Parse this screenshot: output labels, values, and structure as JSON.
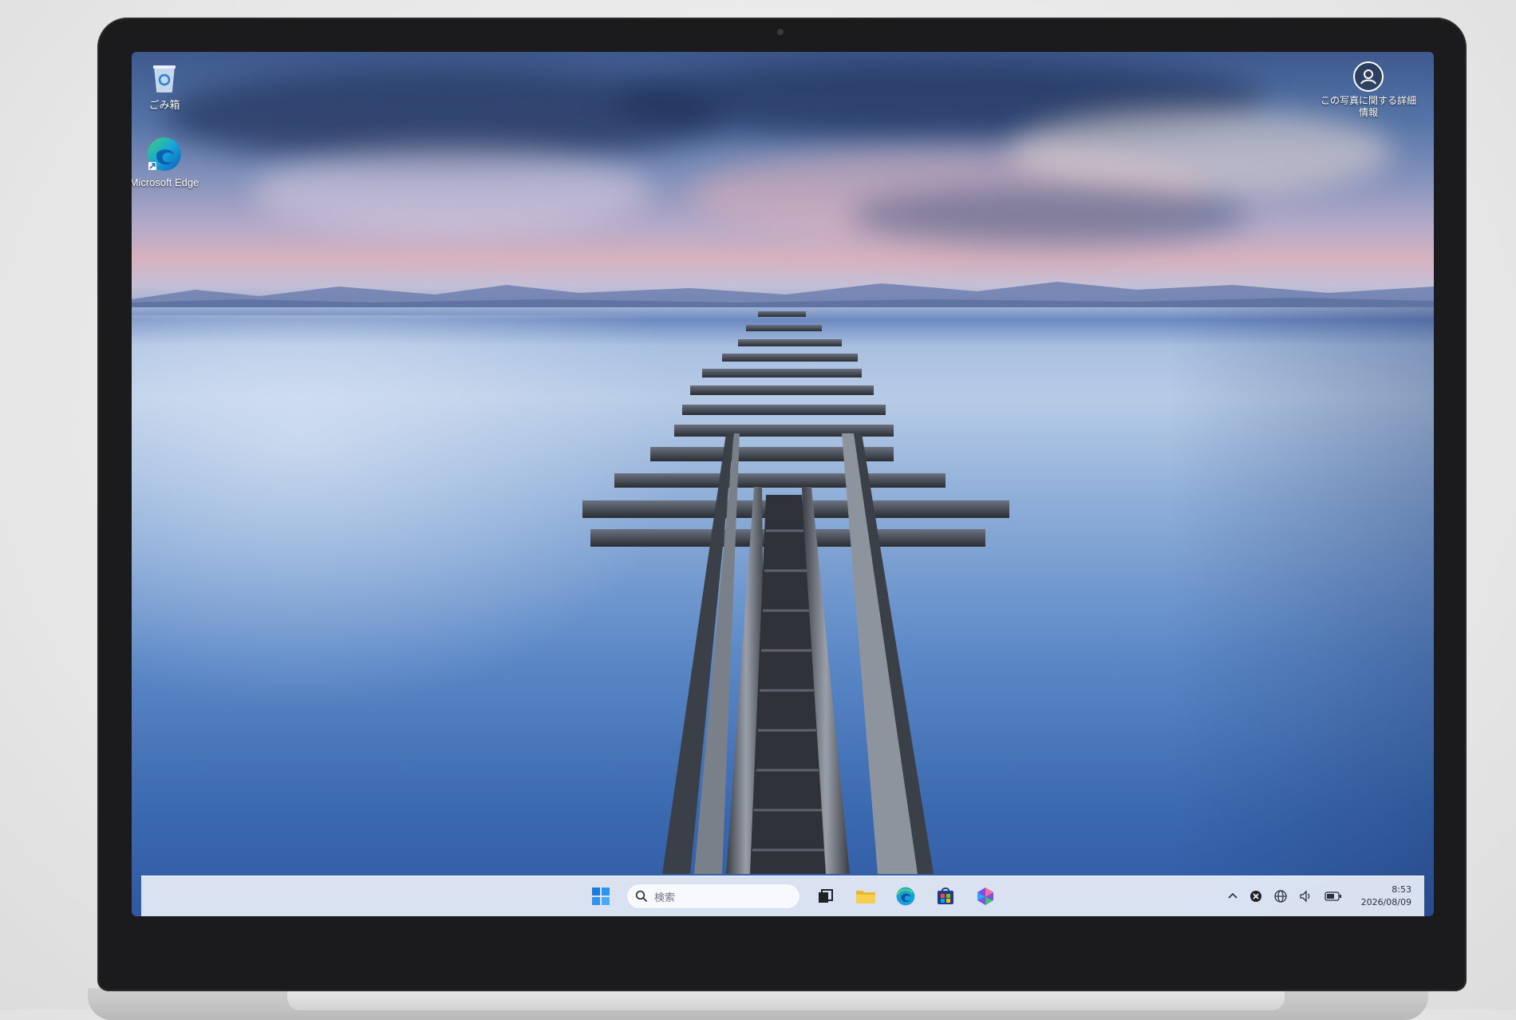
{
  "desktop": {
    "icons": [
      {
        "label": "ごみ箱",
        "icon": "recycle-bin-icon"
      },
      {
        "label": "Microsoft Edge",
        "icon": "edge-icon"
      }
    ],
    "about_photo": {
      "label": "この写真に関する詳細情報",
      "icon": "camera-info-icon"
    }
  },
  "taskbar": {
    "search_placeholder": "検索",
    "apps": [
      "start-icon",
      "task-view-icon",
      "file-explorer-icon",
      "edge-icon",
      "store-icon",
      "m365-icon"
    ],
    "tray_icons": [
      "chevron-up-icon",
      "close-circle-icon",
      "network-icon",
      "volume-icon",
      "battery-icon"
    ],
    "time": "8:53",
    "date": "2026/08/09"
  },
  "colors": {
    "taskbar_bg": "#e8eef8",
    "accent_blue": "#0f6cbd",
    "bezel": "#1b1b1d"
  }
}
